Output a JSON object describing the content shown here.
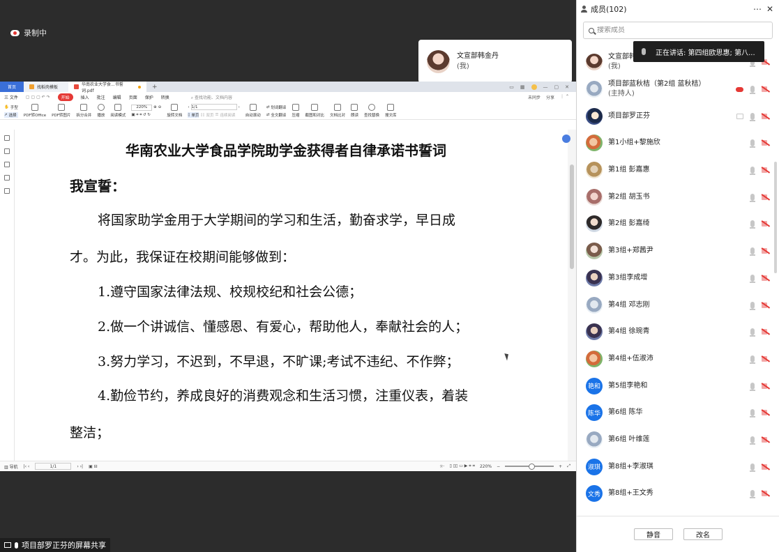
{
  "meeting": {
    "recording_label": "录制中",
    "share_label": "项目部罗正芬的屏幕共享",
    "speaker_card": {
      "name": "文宣部韩金丹",
      "sub": "(我)"
    }
  },
  "pdf_app": {
    "tabs": [
      "首页",
      "找稻壳模板",
      "华南农业大学食...书誓词.pdf"
    ],
    "menu": {
      "file": "三 文件",
      "items": [
        "开始",
        "插入",
        "批注",
        "编辑",
        "页面",
        "保护",
        "转换"
      ],
      "search_placeholder": "查找功能、文档内容",
      "right": [
        "未同步",
        "分享"
      ]
    },
    "toolbar": {
      "hand": "手型",
      "select": "选择",
      "pdf_to_office": "PDF转Office",
      "pdf_to_image": "PDF转图片",
      "split_merge": "拆分合并",
      "play": "播放",
      "read_mode": "阅读模式",
      "zoom": "220%",
      "page": "1/1",
      "rotate_doc": "旋转文档",
      "single_page": "单页",
      "double_page": "双页",
      "continuous": "连续阅读",
      "auto_scroll": "自动滚动",
      "translate": "划词翻译",
      "full_translate": "全文翻译",
      "compress": "压缩",
      "screenshot_compare": "截图和对比",
      "doc_compare": "文档比对",
      "read_aloud": "朗读",
      "find_replace": "查找替换",
      "search_lib": "搜文库"
    },
    "document": {
      "title": "华南农业大学食品学院助学金获得者自律承诺书誓词",
      "oath": "我宣誓：",
      "p1_line1": "将国家助学金用于大学期间的学习和生活，勤奋求学，早日成",
      "p1_line2": "才。为此，我保证在校期间能够做到：",
      "item1": "1.遵守国家法律法规、校规校纪和社会公德；",
      "item2": "2.做一个讲诚信、懂感恩、有爱心，帮助他人，奉献社会的人；",
      "item3": "3.努力学习，不迟到，不早退，不旷课;考试不违纪、不作弊；",
      "item4_line1": "4.勤俭节约，养成良好的消费观念和生活习惯，注重仪表，着装",
      "item4_line2": "整洁；"
    },
    "statusbar": {
      "nav": "导航",
      "page": "1/1",
      "zoom": "220%"
    }
  },
  "panel": {
    "title": "成员(102)",
    "search_placeholder": "搜索成员",
    "speaking_tip": "正在讲话: 第四组欧思惠; 第八...",
    "members": [
      {
        "name": "文宣部韩金丹",
        "role": "(我)",
        "avatar": "photo"
      },
      {
        "name": "项目部蓝秋桔（第2组 蓝秋桔）",
        "role": "(主持人)",
        "avatar": "photo5"
      },
      {
        "name": "项目部罗正芬",
        "role": "",
        "avatar": "photo9"
      },
      {
        "name": "第1小组+黎施欣",
        "role": "",
        "avatar": "photo6"
      },
      {
        "name": "第1组 彭嘉惠",
        "role": "",
        "avatar": "photo7"
      },
      {
        "name": "第2组 胡玉书",
        "role": "",
        "avatar": "photo8"
      },
      {
        "name": "第2组 彭嘉绮",
        "role": "",
        "avatar": "photo2"
      },
      {
        "name": "第3组+郑茜尹",
        "role": "",
        "avatar": "photo3"
      },
      {
        "name": "第3组李成增",
        "role": "",
        "avatar": "photo4"
      },
      {
        "name": "第4组 邓志刚",
        "role": "",
        "avatar": "photo5"
      },
      {
        "name": "第4组 徐琬青",
        "role": "",
        "avatar": "photo4"
      },
      {
        "name": "第4组+伍淑沛",
        "role": "",
        "avatar": "photo6"
      },
      {
        "name": "第5组李艳和",
        "role": "",
        "avatar": "text",
        "initials": "艳和"
      },
      {
        "name": "第6组 陈华",
        "role": "",
        "avatar": "text",
        "initials": "陈华"
      },
      {
        "name": "第6组 叶维莲",
        "role": "",
        "avatar": "photo5"
      },
      {
        "name": "第8组+李淑琪",
        "role": "",
        "avatar": "text",
        "initials": "淑琪"
      },
      {
        "name": "第8组+王文秀",
        "role": "",
        "avatar": "text",
        "initials": "文秀"
      }
    ],
    "buttons": {
      "mute": "静音",
      "rename": "改名"
    }
  }
}
